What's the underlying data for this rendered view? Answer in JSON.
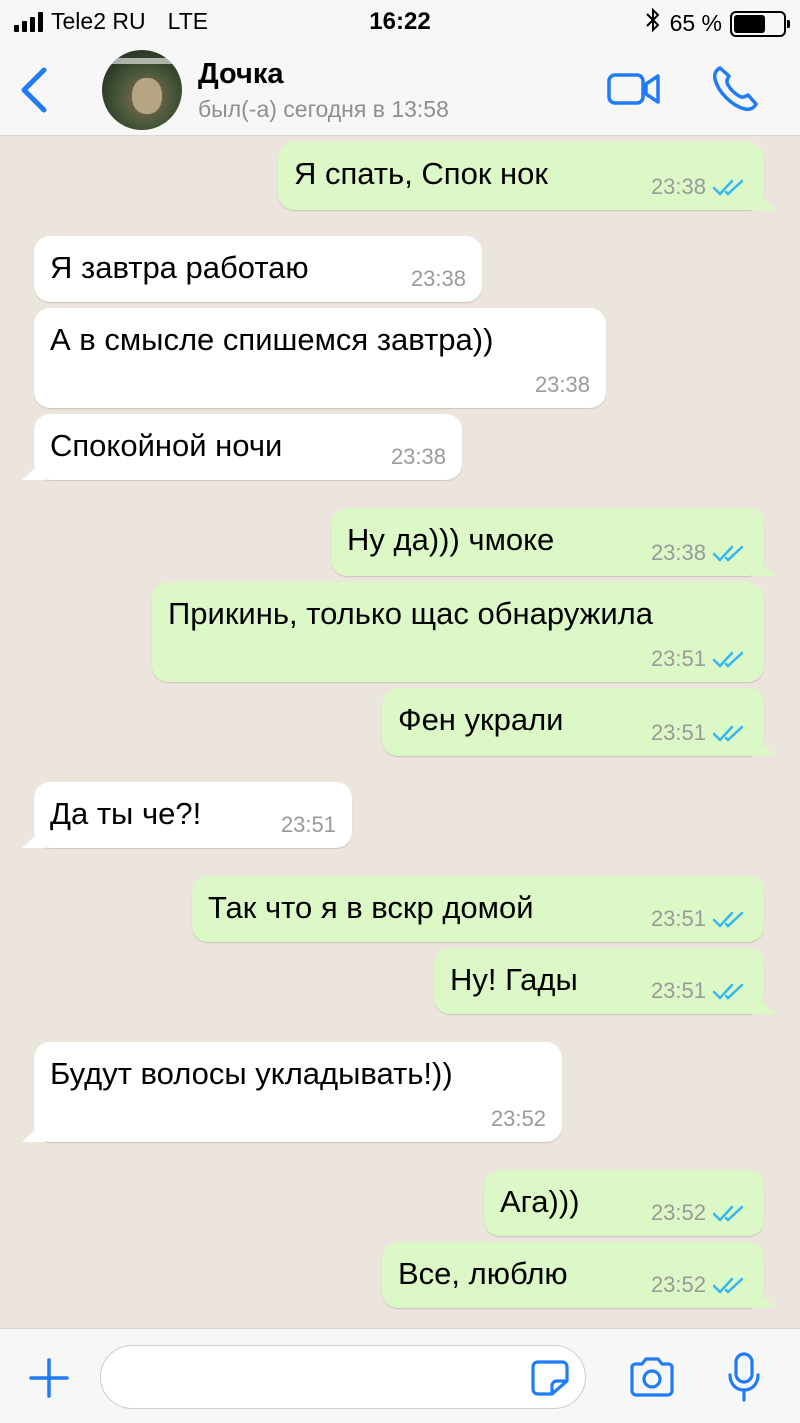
{
  "status_bar": {
    "carrier": "Tele2 RU",
    "network": "LTE",
    "time": "16:22",
    "battery_percent": "65 %",
    "battery_level": 0.65
  },
  "header": {
    "contact_name": "Дочка",
    "last_seen": "был(-а) сегодня в 13:58"
  },
  "messages": [
    {
      "dir": "out",
      "text": "Я спать, Спок нок",
      "time": "23:38"
    },
    {
      "dir": "in",
      "text": "Я завтра работаю",
      "time": "23:38"
    },
    {
      "dir": "in",
      "text": "А в смысле спишемся завтра))",
      "time": "23:38"
    },
    {
      "dir": "in",
      "text": "Спокойной ночи",
      "time": "23:38"
    },
    {
      "dir": "out",
      "text": "Ну да))) чмоке",
      "time": "23:38"
    },
    {
      "dir": "out",
      "text": "Прикинь, только щас обнаружила",
      "time": "23:51"
    },
    {
      "dir": "out",
      "text": "Фен украли",
      "time": "23:51"
    },
    {
      "dir": "in",
      "text": "Да ты че?!",
      "time": "23:51"
    },
    {
      "dir": "out",
      "text": "Так что я в вскр домой",
      "time": "23:51"
    },
    {
      "dir": "out",
      "text": "Ну! Гады",
      "time": "23:51"
    },
    {
      "dir": "in",
      "text": "Будут волосы укладывать!))",
      "time": "23:52"
    },
    {
      "dir": "out",
      "text": "Ага)))",
      "time": "23:52"
    },
    {
      "dir": "out",
      "text": "Все, люблю",
      "time": "23:52"
    }
  ],
  "colors": {
    "accent": "#1F7BF6",
    "outgoing_bubble": "#DCF8C6",
    "incoming_bubble": "#FFFFFF",
    "read_ticks": "#34B7F1",
    "chat_background": "#ECE5DD"
  }
}
